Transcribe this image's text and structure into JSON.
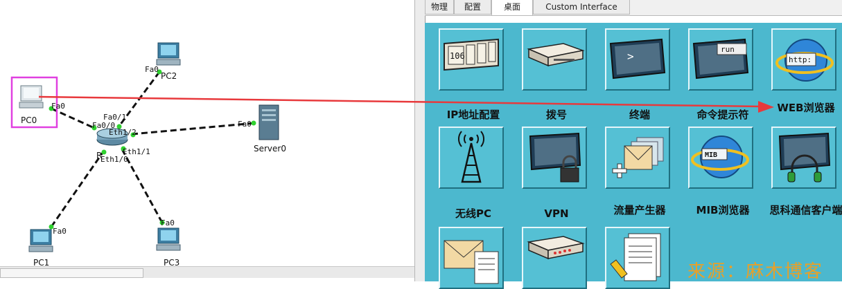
{
  "topology": {
    "devices": {
      "pc0": "PC0",
      "pc1": "PC1",
      "pc2": "PC2",
      "pc3": "PC3",
      "server0": "Server0",
      "router": "R"
    },
    "ports": {
      "pc0_fa0": "Fa0",
      "pc1_fa0": "Fa0",
      "pc2_fa0": "Fa0",
      "pc3_fa0": "Fa0",
      "server_fa0": "Fa0",
      "r_fa00": "Fa0/0",
      "r_fa01": "Fa0/1",
      "r_eth12": "Eth1/2",
      "r_eth11": "Eth1/1",
      "r_eth10": "Eth1/0"
    }
  },
  "tabs": [
    "物理",
    "配置",
    "桌面",
    "Custom Interface"
  ],
  "active_tab": "桌面",
  "apps": [
    {
      "label": "IP地址配置",
      "icon": "ip-config-icon"
    },
    {
      "label": "拨号",
      "icon": "modem-icon"
    },
    {
      "label": "终端",
      "icon": "terminal-icon"
    },
    {
      "label": "命令提示符",
      "icon": "command-prompt-icon"
    },
    {
      "label": "WEB浏览器",
      "icon": "web-browser-icon"
    },
    {
      "label": "无线PC",
      "icon": "wireless-tower-icon"
    },
    {
      "label": "VPN",
      "icon": "vpn-lock-icon"
    },
    {
      "label": "流量产生器",
      "icon": "traffic-generator-icon"
    },
    {
      "label": "MIB浏览器",
      "icon": "mib-browser-icon"
    },
    {
      "label": "思科通信客户端",
      "icon": "headset-icon"
    },
    {
      "label": "",
      "icon": "email-icon"
    },
    {
      "label": "",
      "icon": "pppoe-dialer-icon"
    },
    {
      "label": "",
      "icon": "text-editor-icon"
    }
  ],
  "icon_texts": {
    "ip": "106",
    "prompt": ">",
    "run": "run",
    "http": "http:",
    "mib": "MIB"
  },
  "watermark": "来源：麻木博客",
  "colors": {
    "desktop_bg": "#4cb8ce",
    "arrow": "#e8393c",
    "highlight": "#e040e0",
    "watermark": "#e8a028"
  }
}
